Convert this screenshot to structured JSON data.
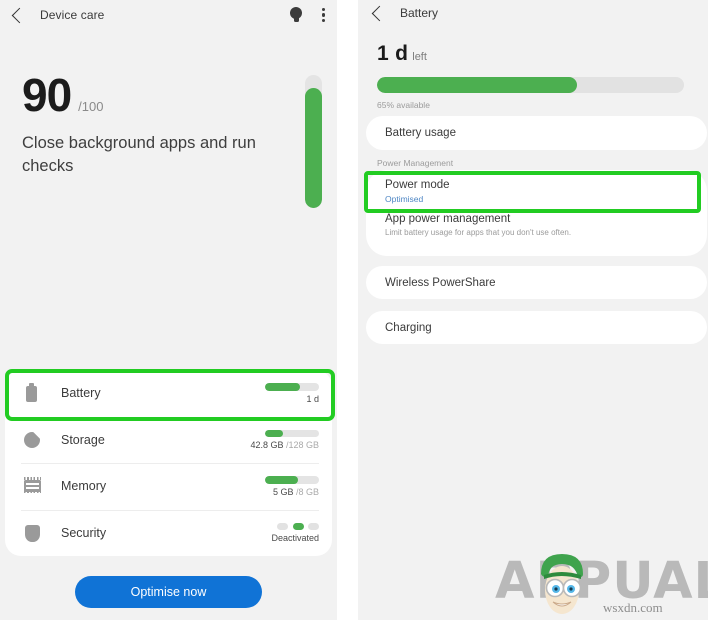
{
  "left_screen": {
    "topbar": {
      "back_icon": "chevron-left-icon",
      "title": "Device care",
      "bulb_icon": "lightbulb-icon",
      "overflow_icon": "kebab-menu-icon"
    },
    "score": {
      "value": "90",
      "denominator": "/100",
      "message": "Close background apps and run checks",
      "indicator_percent": 90
    },
    "items": [
      {
        "icon": "battery-icon",
        "label": "Battery",
        "value": "1 d",
        "value_dim": "",
        "bar_percent": 65,
        "type": "bar",
        "highlighted": true
      },
      {
        "icon": "storage-icon",
        "label": "Storage",
        "value": "42.8 GB ",
        "value_dim": "/128 GB",
        "bar_percent": 34,
        "type": "bar",
        "highlighted": false
      },
      {
        "icon": "memory-icon",
        "label": "Memory",
        "value": "5 GB ",
        "value_dim": "/8 GB",
        "bar_percent": 62,
        "type": "bar",
        "highlighted": false
      },
      {
        "icon": "shield-icon",
        "label": "Security",
        "value": "Deactivated",
        "value_dim": "",
        "bar_percent": 0,
        "type": "dots",
        "highlighted": false
      }
    ],
    "primary_button": "Optimise now",
    "highlight_color": "#22cc22",
    "accent_button_color": "#1073d6"
  },
  "right_screen": {
    "topbar": {
      "back_icon": "chevron-left-icon",
      "title": "Battery"
    },
    "hero": {
      "time_remaining": "1 d",
      "time_suffix": "left",
      "bar_percent": 65,
      "availability": "65% available"
    },
    "battery_usage_label": "Battery usage",
    "section_label": "Power Management",
    "power_mode": {
      "title": "Power mode",
      "subtitle": "Optimised",
      "subtitle_color": "#4f87c4",
      "highlighted": true
    },
    "app_power_management": {
      "title": "App power management",
      "subtitle": "Limit battery usage for apps that you don't use often."
    },
    "wireless_powershare_label": "Wireless PowerShare",
    "charging_label": "Charging",
    "highlight_color": "#22cc22"
  },
  "watermark": {
    "brand": "APPUALS",
    "url": "wsxdn.com",
    "mascot_icon": "cartoon-mascot-icon"
  }
}
